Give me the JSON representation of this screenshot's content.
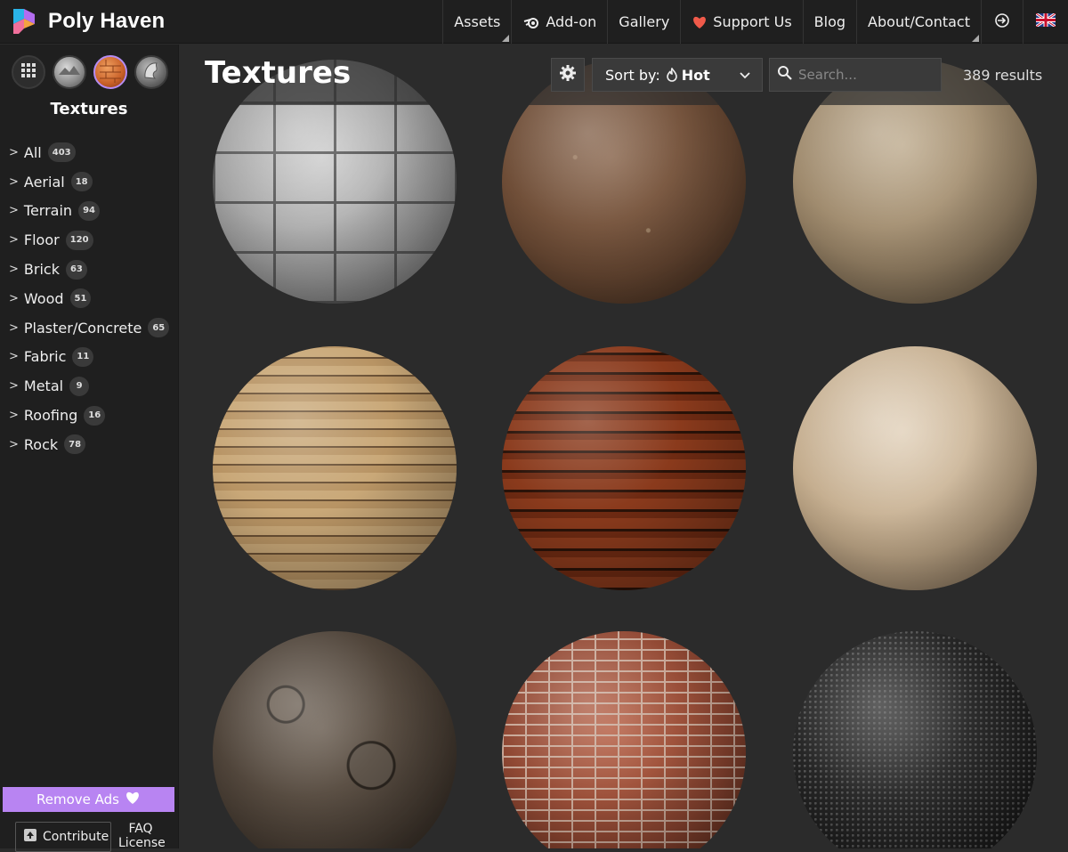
{
  "app": {
    "name": "Poly Haven"
  },
  "nav": {
    "assets": "Assets",
    "addon": "Add-on",
    "gallery": "Gallery",
    "support": "Support Us",
    "blog": "Blog",
    "about": "About/Contact"
  },
  "sidebar": {
    "title": "Textures",
    "asset_types": [
      "all-assets-icon",
      "hdri-icon",
      "texture-icon",
      "model-icon"
    ],
    "categories": [
      {
        "label": "All",
        "count": "403"
      },
      {
        "label": "Aerial",
        "count": "18"
      },
      {
        "label": "Terrain",
        "count": "94"
      },
      {
        "label": "Floor",
        "count": "120"
      },
      {
        "label": "Brick",
        "count": "63"
      },
      {
        "label": "Wood",
        "count": "51"
      },
      {
        "label": "Plaster/Concrete",
        "count": "65"
      },
      {
        "label": "Fabric",
        "count": "11"
      },
      {
        "label": "Metal",
        "count": "9"
      },
      {
        "label": "Roofing",
        "count": "16"
      },
      {
        "label": "Rock",
        "count": "78"
      }
    ],
    "remove_ads": "Remove Ads",
    "contribute": "Contribute",
    "faq": "FAQ",
    "license": "License"
  },
  "main": {
    "title": "Textures",
    "sort_label": "Sort by:",
    "sort_value": "Hot",
    "search_placeholder": "Search...",
    "results": "389 results"
  },
  "colors": {
    "accent": "#b884f2",
    "topbar": "#1f1f1f",
    "background": "#2b2b2b"
  },
  "textures": [
    "granite-block-wall",
    "dirt-ground",
    "concrete-plaster",
    "old-wood-planks",
    "dark-varnished-wood",
    "light-wood-floor",
    "rock-pavement",
    "red-brick-wall",
    "black-gravel"
  ]
}
